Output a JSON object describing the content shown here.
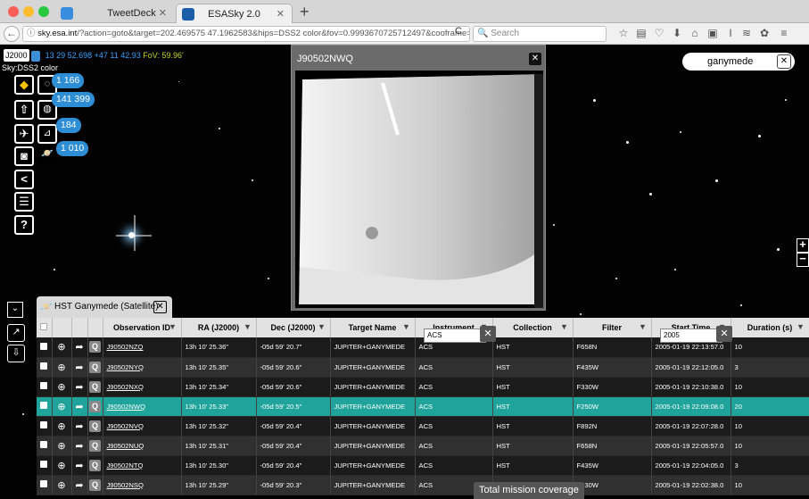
{
  "browser": {
    "tabs": [
      {
        "label": "TweetDeck"
      },
      {
        "label": "ESASky 2.0"
      }
    ],
    "url_domain": "sky.esa.int",
    "url_rest": "/?action=goto&target=202.469575 47.1962583&hips=DSS2 color&fov=0.9993670725712497&cooframe=J200",
    "search_placeholder": "Search"
  },
  "sky": {
    "frame": "J2000",
    "coordinates": "13 29 52.698 +47 11 42.93",
    "fov": "FoV: 59.96'",
    "survey_label": "Sky:DSS2 color",
    "target_search_value": "ganymede"
  },
  "counts": {
    "images": "1 166",
    "catalogues": "141 399",
    "spectra": "184",
    "ssos": "1 010"
  },
  "popup": {
    "title": "J90502NWQ"
  },
  "panel": {
    "tab_label": "HST Ganymede (Satellite)"
  },
  "table": {
    "columns": [
      "Observation ID",
      "RA (J2000)",
      "Dec (J2000)",
      "Target Name",
      "Instrument",
      "Collection",
      "Filter",
      "Start Time",
      "Duration (s)"
    ],
    "instrument_filter": "ACS",
    "start_time_filter": "2005",
    "rows": [
      [
        "J90502NZQ",
        "13h 10' 25.36\"",
        "-05d 59' 20.7\"",
        "JUPITER+GANYMEDE",
        "ACS",
        "HST",
        "F658N",
        "2005-01-19 22:13:57.0",
        "10"
      ],
      [
        "J90502NYQ",
        "13h 10' 25.35\"",
        "-05d 59' 20.6\"",
        "JUPITER+GANYMEDE",
        "ACS",
        "HST",
        "F435W",
        "2005-01-19 22:12:05.0",
        "3"
      ],
      [
        "J90502NXQ",
        "13h 10' 25.34\"",
        "-05d 59' 20.6\"",
        "JUPITER+GANYMEDE",
        "ACS",
        "HST",
        "F330W",
        "2005-01-19 22:10:38.0",
        "10"
      ],
      [
        "J90502NWQ",
        "13h 10' 25.33\"",
        "-05d 59' 20.5\"",
        "JUPITER+GANYMEDE",
        "ACS",
        "HST",
        "F250W",
        "2005-01-19 22:09:08.0",
        "20"
      ],
      [
        "J90502NVQ",
        "13h 10' 25.32\"",
        "-05d 59' 20.4\"",
        "JUPITER+GANYMEDE",
        "ACS",
        "HST",
        "F892N",
        "2005-01-19 22:07:28.0",
        "10"
      ],
      [
        "J90502NUQ",
        "13h 10' 25.31\"",
        "-05d 59' 20.4\"",
        "JUPITER+GANYMEDE",
        "ACS",
        "HST",
        "F658N",
        "2005-01-19 22:05:57.0",
        "10"
      ],
      [
        "J90502NTQ",
        "13h 10' 25.30\"",
        "-05d 59' 20.4\"",
        "JUPITER+GANYMEDE",
        "ACS",
        "HST",
        "F435W",
        "2005-01-19 22:04:05.0",
        "3"
      ],
      [
        "J90502NSQ",
        "13h 10' 25.29\"",
        "-05d 59' 20.3\"",
        "JUPITER+GANYMEDE",
        "ACS",
        "HST",
        "F330W",
        "2005-01-19 22:02:38.0",
        "10"
      ]
    ],
    "selected_row": 3
  },
  "coverage_label": "Total mission coverage",
  "colors": {
    "accent": "#2d8ed6",
    "selected_row": "#1fa39a",
    "fov_text": "#c5d820"
  }
}
